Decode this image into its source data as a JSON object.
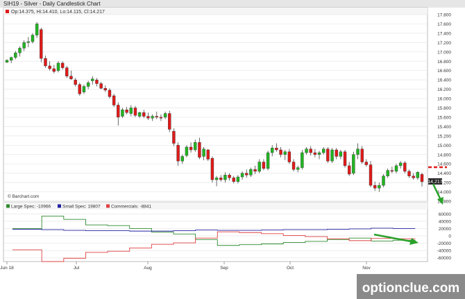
{
  "chart_title": "SIH19 - Silver - Daily Candlestick Chart",
  "ohlc_info": "Op:14.375, Hi:14.410, Lo:14.115, Cl:14.217",
  "last_price_label": "14.217",
  "source_label": "© Barchart.com",
  "watermark": "optionclue.com",
  "colors": {
    "up": "#21b621",
    "down": "#e11a1a",
    "large_spec": "#2e8b2e",
    "small_spec": "#2020a0",
    "commercials": "#e04040",
    "annotation_green": "#2aa12a",
    "annotation_red": "#e11a1a"
  },
  "chart_data": [
    {
      "type": "candlestick",
      "title": "SIH19 - Silver - Daily Candlestick Chart",
      "ylim": [
        13.8,
        17.8
      ],
      "y_ticks": [
        "17.800",
        "17.600",
        "17.400",
        "17.200",
        "17.000",
        "16.800",
        "16.600",
        "16.400",
        "16.200",
        "16.000",
        "15.800",
        "15.600",
        "15.400",
        "15.200",
        "15.000",
        "14.800",
        "14.600",
        "14.400",
        "14.200",
        "14.000",
        "13.800"
      ],
      "x_labels": [
        "Jun 18",
        "Jul",
        "Aug",
        "Sep",
        "Oct",
        "Nov"
      ],
      "candles": [
        [
          16.78,
          16.84,
          16.76,
          16.82
        ],
        [
          16.82,
          16.9,
          16.76,
          16.88
        ],
        [
          16.88,
          17.02,
          16.84,
          16.98
        ],
        [
          16.98,
          17.12,
          16.9,
          17.08
        ],
        [
          17.08,
          17.25,
          17.02,
          17.2
        ],
        [
          17.2,
          17.32,
          17.1,
          17.22
        ],
        [
          17.22,
          17.4,
          17.18,
          17.36
        ],
        [
          17.36,
          17.64,
          17.3,
          17.6
        ],
        [
          17.48,
          17.52,
          16.78,
          16.86
        ],
        [
          16.86,
          16.92,
          16.66,
          16.7
        ],
        [
          16.7,
          16.8,
          16.6,
          16.64
        ],
        [
          16.64,
          16.72,
          16.54,
          16.58
        ],
        [
          16.6,
          16.8,
          16.56,
          16.76
        ],
        [
          16.76,
          16.8,
          16.62,
          16.66
        ],
        [
          16.66,
          16.7,
          16.44,
          16.48
        ],
        [
          16.48,
          16.6,
          16.4,
          16.42
        ],
        [
          16.4,
          16.44,
          16.26,
          16.3
        ],
        [
          16.3,
          16.34,
          16.06,
          16.1
        ],
        [
          16.14,
          16.3,
          16.1,
          16.26
        ],
        [
          16.26,
          16.38,
          16.2,
          16.34
        ],
        [
          16.38,
          16.48,
          16.3,
          16.42
        ],
        [
          16.4,
          16.44,
          16.26,
          16.32
        ],
        [
          16.32,
          16.36,
          16.2,
          16.22
        ],
        [
          16.22,
          16.28,
          16.14,
          16.18
        ],
        [
          16.18,
          16.22,
          16.0,
          16.04
        ],
        [
          16.06,
          16.1,
          15.82,
          15.86
        ],
        [
          15.86,
          15.92,
          15.42,
          15.6
        ],
        [
          15.62,
          15.8,
          15.58,
          15.76
        ],
        [
          15.76,
          15.82,
          15.66,
          15.7
        ],
        [
          15.68,
          15.86,
          15.62,
          15.8
        ],
        [
          15.8,
          15.84,
          15.6,
          15.64
        ],
        [
          15.62,
          15.72,
          15.58,
          15.7
        ],
        [
          15.7,
          15.76,
          15.58,
          15.62
        ],
        [
          15.62,
          15.7,
          15.54,
          15.58
        ],
        [
          15.58,
          15.66,
          15.52,
          15.62
        ],
        [
          15.62,
          15.72,
          15.56,
          15.6
        ],
        [
          15.6,
          15.66,
          15.52,
          15.58
        ],
        [
          15.6,
          15.72,
          15.56,
          15.68
        ],
        [
          15.68,
          15.74,
          15.28,
          15.34
        ],
        [
          15.3,
          15.36,
          14.98,
          15.04
        ],
        [
          15.0,
          15.06,
          14.56,
          14.66
        ],
        [
          14.66,
          14.8,
          14.6,
          14.76
        ],
        [
          14.78,
          15.0,
          14.74,
          14.96
        ],
        [
          14.96,
          15.06,
          14.84,
          14.9
        ],
        [
          14.9,
          15.12,
          14.86,
          15.06
        ],
        [
          15.06,
          15.16,
          14.7,
          14.74
        ],
        [
          14.76,
          14.96,
          14.68,
          14.92
        ],
        [
          14.9,
          14.92,
          14.66,
          14.7
        ],
        [
          14.72,
          14.76,
          14.2,
          14.26
        ],
        [
          14.26,
          14.34,
          14.12,
          14.3
        ],
        [
          14.3,
          14.36,
          14.22,
          14.26
        ],
        [
          14.26,
          14.42,
          14.2,
          14.36
        ],
        [
          14.36,
          14.4,
          14.24,
          14.3
        ],
        [
          14.3,
          14.34,
          14.18,
          14.22
        ],
        [
          14.22,
          14.36,
          14.18,
          14.32
        ],
        [
          14.32,
          14.44,
          14.26,
          14.4
        ],
        [
          14.4,
          14.48,
          14.3,
          14.36
        ],
        [
          14.36,
          14.52,
          14.32,
          14.48
        ],
        [
          14.48,
          14.56,
          14.38,
          14.44
        ],
        [
          14.44,
          14.7,
          14.4,
          14.64
        ],
        [
          14.64,
          14.7,
          14.46,
          14.5
        ],
        [
          14.5,
          14.88,
          14.46,
          14.84
        ],
        [
          14.84,
          15.0,
          14.76,
          14.94
        ],
        [
          14.94,
          15.04,
          14.86,
          14.9
        ],
        [
          14.9,
          14.96,
          14.74,
          14.8
        ],
        [
          14.8,
          14.9,
          14.68,
          14.86
        ],
        [
          14.86,
          14.92,
          14.6,
          14.64
        ],
        [
          14.64,
          14.7,
          14.44,
          14.48
        ],
        [
          14.48,
          14.56,
          14.42,
          14.52
        ],
        [
          14.52,
          14.9,
          14.48,
          14.84
        ],
        [
          14.84,
          14.96,
          14.8,
          14.92
        ],
        [
          14.92,
          14.98,
          14.78,
          14.84
        ],
        [
          14.84,
          14.92,
          14.74,
          14.8
        ],
        [
          14.8,
          14.88,
          14.7,
          14.84
        ],
        [
          14.84,
          14.96,
          14.8,
          14.92
        ],
        [
          14.92,
          14.96,
          14.62,
          14.66
        ],
        [
          14.66,
          14.94,
          14.62,
          14.9
        ],
        [
          14.9,
          14.94,
          14.7,
          14.76
        ],
        [
          14.76,
          14.9,
          14.7,
          14.86
        ],
        [
          14.86,
          14.9,
          14.52,
          14.56
        ],
        [
          14.56,
          14.64,
          14.34,
          14.38
        ],
        [
          14.4,
          14.86,
          14.36,
          14.8
        ],
        [
          14.8,
          15.04,
          14.7,
          14.92
        ],
        [
          14.92,
          14.98,
          14.6,
          14.64
        ],
        [
          14.64,
          14.7,
          14.54,
          14.58
        ],
        [
          14.58,
          14.66,
          14.1,
          14.14
        ],
        [
          14.14,
          14.22,
          14.02,
          14.08
        ],
        [
          14.08,
          14.2,
          14.0,
          14.14
        ],
        [
          14.14,
          14.38,
          14.1,
          14.34
        ],
        [
          14.34,
          14.5,
          14.3,
          14.46
        ],
        [
          14.46,
          14.54,
          14.4,
          14.44
        ],
        [
          14.44,
          14.6,
          14.4,
          14.56
        ],
        [
          14.56,
          14.66,
          14.5,
          14.62
        ],
        [
          14.62,
          14.66,
          14.4,
          14.44
        ],
        [
          14.44,
          14.48,
          14.3,
          14.34
        ],
        [
          14.34,
          14.4,
          14.26,
          14.3
        ],
        [
          14.3,
          14.44,
          14.26,
          14.42
        ],
        [
          14.375,
          14.41,
          14.115,
          14.217
        ]
      ]
    },
    {
      "type": "line",
      "title": "",
      "ylim": [
        -70000,
        70000
      ],
      "y_ticks": [
        "60000",
        "40000",
        "20000",
        "0",
        "-20000",
        "-40000",
        "-60000"
      ],
      "x_labels": [
        "Jun 18",
        "Jul",
        "Aug",
        "Sep",
        "Oct",
        "Nov"
      ],
      "series": [
        {
          "name": "Large Spec: -10966",
          "values": [
            20000,
            20000,
            20000,
            20000,
            54000,
            54000,
            54000,
            45000,
            45000,
            45000,
            30000,
            30000,
            30000,
            28000,
            28000,
            28000,
            20000,
            20000,
            20000,
            10000,
            10000,
            10000,
            5000,
            5000,
            5000,
            -10000,
            -10000,
            -10000,
            -26000,
            -26000,
            -26000,
            -24000,
            -24000,
            -24000,
            -22000,
            -22000,
            -22000,
            -18000,
            -18000,
            -18000,
            -15000,
            -15000,
            -15000,
            -10000,
            -10000,
            -10000,
            -6000,
            -6000,
            -6000,
            -14000,
            -14000,
            -14000,
            -12000,
            -12000,
            -12000,
            -10966
          ]
        },
        {
          "name": "Small Spec: 19807",
          "values": [
            18000,
            18000,
            18000,
            18000,
            17000,
            17000,
            17000,
            15000,
            15000,
            15000,
            14000,
            14000,
            14000,
            14000,
            14000,
            14000,
            13000,
            13000,
            13000,
            13000,
            13000,
            13000,
            14000,
            14000,
            14000,
            16000,
            16000,
            16000,
            15000,
            15000,
            15000,
            15000,
            15000,
            15000,
            16000,
            16000,
            16000,
            17000,
            17000,
            17000,
            17000,
            17000,
            17000,
            18000,
            18000,
            18000,
            19000,
            19000,
            19000,
            21000,
            21000,
            21000,
            20000,
            20000,
            20000,
            19807
          ]
        },
        {
          "name": "Commercials: -8841",
          "values": [
            -38000,
            -38000,
            -38000,
            -38000,
            -70000,
            -70000,
            -70000,
            -61000,
            -61000,
            -61000,
            -45000,
            -45000,
            -45000,
            -42000,
            -42000,
            -42000,
            -33000,
            -33000,
            -33000,
            -23000,
            -23000,
            -23000,
            -19000,
            -19000,
            -19000,
            -6000,
            -6000,
            -6000,
            11000,
            11000,
            11000,
            9000,
            9000,
            9000,
            6000,
            6000,
            6000,
            1000,
            1000,
            1000,
            -2000,
            -2000,
            -2000,
            -8000,
            -8000,
            -8000,
            -13000,
            -13000,
            -13000,
            -7000,
            -7000,
            -7000,
            -8000,
            -8000,
            -8000,
            -8841
          ]
        }
      ]
    }
  ]
}
